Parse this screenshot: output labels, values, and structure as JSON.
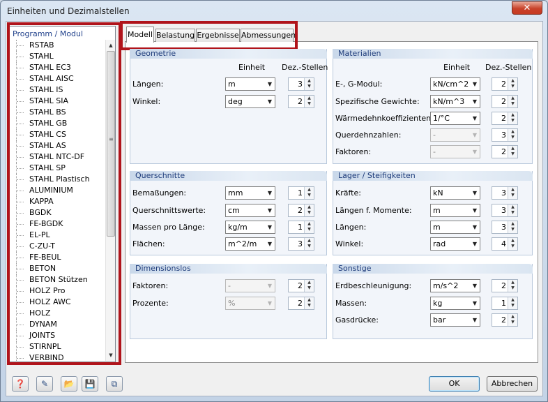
{
  "window": {
    "title": "Einheiten und Dezimalstellen",
    "close_label": "✕"
  },
  "tree": {
    "header": "Programm / Modul",
    "items": [
      "RSTAB",
      "STAHL",
      "STAHL EC3",
      "STAHL AISC",
      "STAHL IS",
      "STAHL SIA",
      "STAHL BS",
      "STAHL GB",
      "STAHL CS",
      "STAHL AS",
      "STAHL NTC-DF",
      "STAHL SP",
      "STAHL Plastisch",
      "ALUMINIUM",
      "KAPPA",
      "BGDK",
      "FE-BGDK",
      "EL-PL",
      "C-ZU-T",
      "FE-BEUL",
      "BETON",
      "BETON Stützen",
      "HOLZ Pro",
      "HOLZ AWC",
      "HOLZ",
      "DYNAM",
      "JOINTS",
      "STIRNPL",
      "VERBIND"
    ],
    "scroll_up": "▲",
    "scroll_down": "▼",
    "scroll_grip": "≡"
  },
  "tabs": [
    "Modell",
    "Belastung",
    "Ergebnisse",
    "Abmessungen"
  ],
  "columns": {
    "unit": "Einheit",
    "decimals": "Dez.-Stellen"
  },
  "geometrie": {
    "title": "Geometrie",
    "rows": [
      {
        "label": "Längen:",
        "unit": "m",
        "dec": "3"
      },
      {
        "label": "Winkel:",
        "unit": "deg",
        "dec": "2"
      }
    ]
  },
  "materialien": {
    "title": "Materialien",
    "rows": [
      {
        "label": "E-, G-Modul:",
        "unit": "kN/cm^2",
        "dec": "2"
      },
      {
        "label": "Spezifische Gewichte:",
        "unit": "kN/m^3",
        "dec": "2"
      },
      {
        "label": "Wärmedehnkoeffizienten:",
        "unit": "1/°C",
        "dec": "2"
      },
      {
        "label": "Querdehnzahlen:",
        "unit": "-",
        "dec": "3"
      },
      {
        "label": "Faktoren:",
        "unit": "-",
        "dec": "2"
      }
    ]
  },
  "querschnitte": {
    "title": "Querschnitte",
    "rows": [
      {
        "label": "Bemaßungen:",
        "unit": "mm",
        "dec": "1"
      },
      {
        "label": "Querschnittswerte:",
        "unit": "cm",
        "dec": "2"
      },
      {
        "label": "Massen pro Länge:",
        "unit": "kg/m",
        "dec": "1"
      },
      {
        "label": "Flächen:",
        "unit": "m^2/m",
        "dec": "3"
      }
    ]
  },
  "lager": {
    "title": "Lager / Steifigkeiten",
    "rows": [
      {
        "label": "Kräfte:",
        "unit": "kN",
        "dec": "3"
      },
      {
        "label": "Längen f. Momente:",
        "unit": "m",
        "dec": "3"
      },
      {
        "label": "Längen:",
        "unit": "m",
        "dec": "3"
      },
      {
        "label": "Winkel:",
        "unit": "rad",
        "dec": "4"
      }
    ]
  },
  "dimensionslos": {
    "title": "Dimensionslos",
    "rows": [
      {
        "label": "Faktoren:",
        "unit": "-",
        "dec": "2"
      },
      {
        "label": "Prozente:",
        "unit": "%",
        "dec": "2"
      }
    ]
  },
  "sonstige": {
    "title": "Sonstige",
    "rows": [
      {
        "label": "Erdbeschleunigung:",
        "unit": "m/s^2",
        "dec": "2"
      },
      {
        "label": "Massen:",
        "unit": "kg",
        "dec": "1"
      },
      {
        "label": "Gasdrücke:",
        "unit": "bar",
        "dec": "2"
      }
    ]
  },
  "toolbar_icons": [
    "help-icon",
    "edit-icon",
    "open-folder-icon",
    "save-icon",
    "import-icon"
  ],
  "buttons": {
    "ok": "OK",
    "cancel": "Abbrechen"
  },
  "colors": {
    "highlight_box": "#b0141b",
    "group_header": "#1d3b7a"
  }
}
